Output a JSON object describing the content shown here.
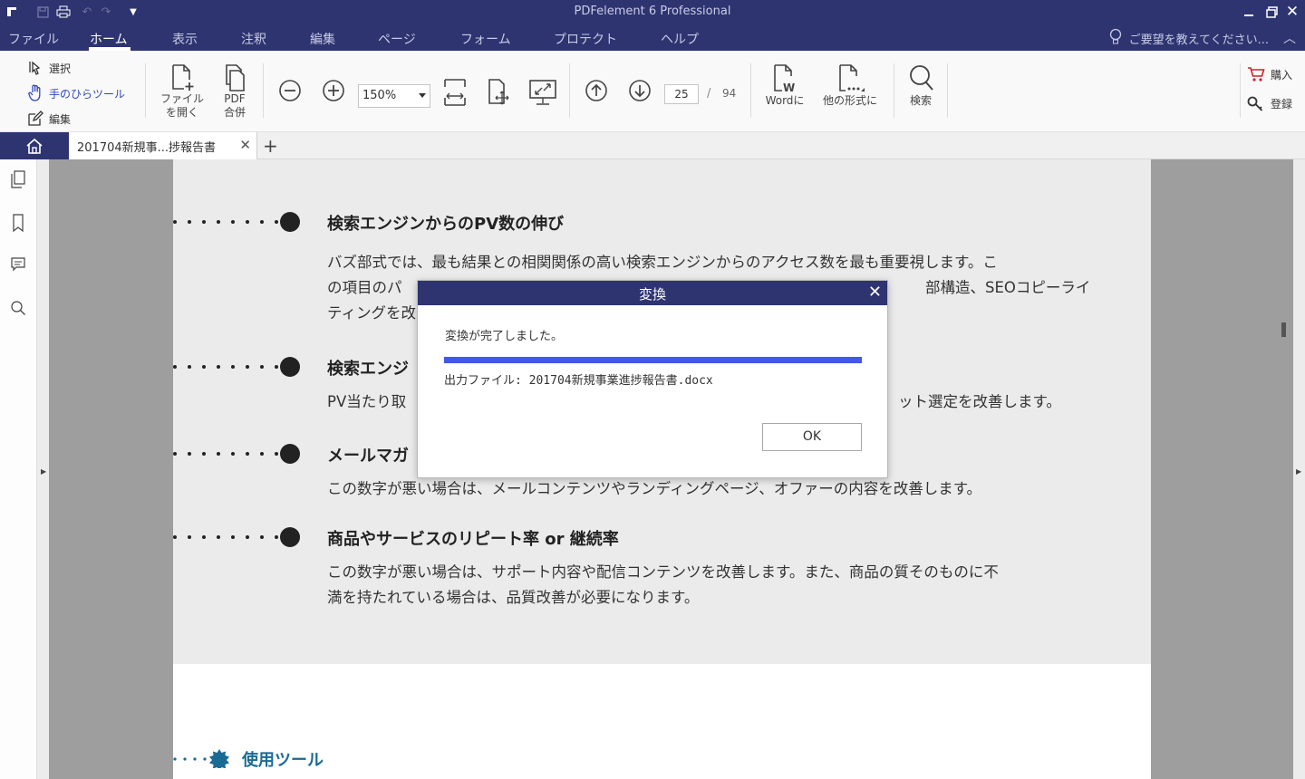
{
  "app": {
    "title": "PDFelement 6 Professional"
  },
  "menu": {
    "items": [
      "ファイル",
      "ホーム",
      "表示",
      "注釈",
      "編集",
      "ページ",
      "フォーム",
      "プロテクト",
      "ヘルプ"
    ],
    "active": "ホーム",
    "hint": "ご要望を教えてください..."
  },
  "ribbon": {
    "select_label": "選択",
    "hand_label": "手のひらツール",
    "edit_label": "編集",
    "open_label_1": "ファイル",
    "open_label_2": "を開く",
    "merge_label_1": "PDF",
    "merge_label_2": "合併",
    "zoom_value": "150%",
    "current_page": "25",
    "page_separator": "/",
    "total_pages": "94",
    "to_word_label": "Wordに",
    "to_other_label": "他の形式に",
    "search_label": "検索",
    "buy_label": "購入",
    "register_label": "登録"
  },
  "tabs": {
    "document_tab": "201704新規事...捗報告書",
    "plus": "+"
  },
  "document": {
    "sections": [
      {
        "heading": "検索エンジンからのPV数の伸び",
        "lines": [
          "バズ部式では、最も結果との相関関係の高い検索エンジンからのアクセス数を最も重要視します。こ",
          "の項目のパ",
          "ティングを改"
        ],
        "line2_tail": "部構造、SEOコピーライ"
      },
      {
        "heading": "検索エンジ",
        "lines": [
          "PV当たり取"
        ],
        "line1_tail": "ット選定を改善します。"
      },
      {
        "heading": "メールマガ",
        "lines": [
          "この数字が悪い場合は、メールコンテンツやランディングページ、オファーの内容を改善します。"
        ]
      },
      {
        "heading": "商品やサービスのリピート率 or 継続率",
        "lines": [
          "この数字が悪い場合は、サポート内容や配信コンテンツを改善します。また、商品の質そのものに不",
          "満を持たれている場合は、品質改善が必要になります。"
        ]
      }
    ],
    "tool_heading": "使用ツール"
  },
  "dialog": {
    "title": "変換",
    "message": "変換が完了しました。",
    "progress": 1.0,
    "output_label": "出力ファイル: 201704新規事業進捗報告書.docx",
    "ok_label": "OK"
  },
  "colors": {
    "titlebar": "#2e3470",
    "progress": "#4158e8",
    "tool_heading": "#1a6b94"
  }
}
